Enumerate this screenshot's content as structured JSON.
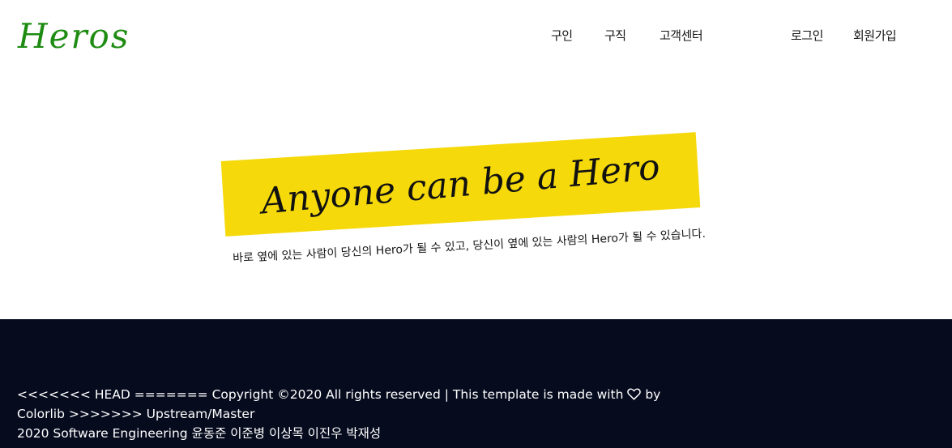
{
  "header": {
    "logo": "Heros",
    "nav_left": [
      "구인",
      "구직",
      "고객센터"
    ],
    "nav_right": [
      "로그인",
      "회원가입"
    ]
  },
  "hero": {
    "title": "Anyone can be a Hero",
    "tagline": "바로 옆에 있는 사람이 당신의 Hero가 될 수 있고,  당신이 옆에 있는 사람의 Hero가 될 수 있습니다.",
    "banner_color": "#f5d90a"
  },
  "footer": {
    "line1_before_icon": "<<<<<<< HEAD ======= Copyright ©2020 All rights reserved | This template is made with ",
    "icon": "heart-icon",
    "line1_after_icon": " by",
    "line2": "Colorlib >>>>>>> Upstream/Master",
    "line3": "2020 Software Engineering 윤동준 이준병 이상목 이진우 박재성",
    "background_color": "#060b1e"
  },
  "colors": {
    "logo": "#1e8c12",
    "accent_yellow": "#f5d90a",
    "footer_bg": "#060b1e"
  }
}
